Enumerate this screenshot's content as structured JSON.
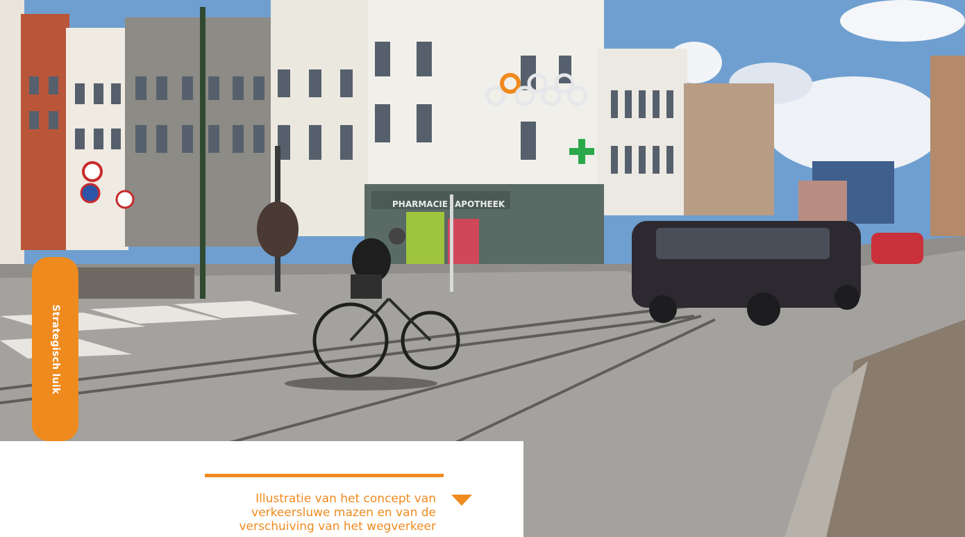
{
  "side_tab": {
    "label": "Strategisch luik"
  },
  "caption": {
    "lines": [
      "Illustratie van het concept van",
      "verkeersluwe mazen en van de",
      "verschuiving van het wegverkeer"
    ]
  },
  "photo": {
    "signs": [
      "PHARMACIE",
      "APOTHEEK"
    ]
  },
  "colors": {
    "accent": "#ef8a1f"
  }
}
